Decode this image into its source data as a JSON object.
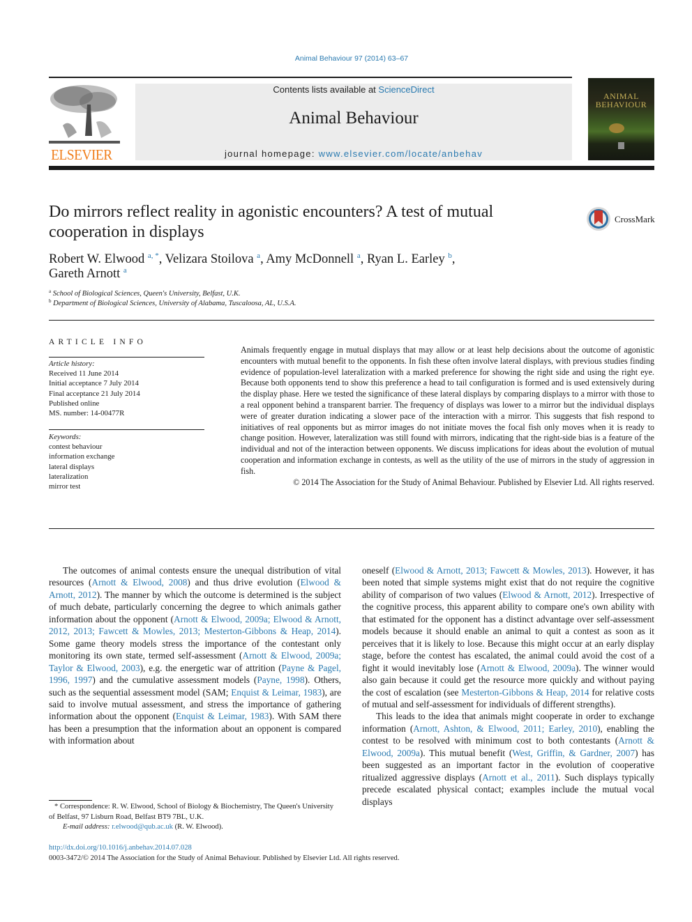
{
  "running_header": "Animal Behaviour 97 (2014) 63–67",
  "masthead": {
    "publisher_logo_text": "ELSEVIER",
    "contents_prefix": "Contents lists available at ",
    "contents_link": "ScienceDirect",
    "journal_title": "Animal Behaviour",
    "homepage_prefix": "journal homepage: ",
    "homepage_link": "www.elsevier.com/locate/anbehav",
    "cover_title_line1": "ANIMAL",
    "cover_title_line2": "BEHAVIOUR",
    "colors": {
      "elsevier_orange": "#f07d1a",
      "link_blue": "#2a7ab0",
      "masthead_gray": "#ececec"
    }
  },
  "article": {
    "title": "Do mirrors reflect reality in agonistic encounters? A test of mutual cooperation in displays",
    "crossmark_label": "CrossMark",
    "authors": [
      {
        "name": "Robert W. Elwood",
        "sup": "a, *"
      },
      {
        "name": "Velizara Stoilova",
        "sup": "a"
      },
      {
        "name": "Amy McDonnell",
        "sup": "a"
      },
      {
        "name": "Ryan L. Earley",
        "sup": "b"
      },
      {
        "name": "Gareth Arnott",
        "sup": "a"
      }
    ],
    "affiliations": [
      {
        "sup": "a",
        "text": "School of Biological Sciences, Queen's University, Belfast, U.K."
      },
      {
        "sup": "b",
        "text": "Department of Biological Sciences, University of Alabama, Tuscaloosa, AL, U.S.A."
      }
    ]
  },
  "article_info": {
    "heading": "ARTICLE INFO",
    "history_label": "Article history:",
    "history": [
      "Received 11 June 2014",
      "Initial acceptance 7 July 2014",
      "Final acceptance 21 July 2014",
      "Published online",
      "MS. number: 14-00477R"
    ],
    "keywords_label": "Keywords:",
    "keywords": [
      "contest behaviour",
      "information exchange",
      "lateral displays",
      "lateralization",
      "mirror test"
    ]
  },
  "abstract": {
    "text": "Animals frequently engage in mutual displays that may allow or at least help decisions about the outcome of agonistic encounters with mutual benefit to the opponents. In fish these often involve lateral displays, with previous studies finding evidence of population-level lateralization with a marked pref­erence for showing the right side and using the right eye. Because both opponents tend to show this preference a head to tail configuration is formed and is used extensively during the display phase. Here we tested the significance of these lateral displays by comparing displays to a mirror with those to a real opponent behind a transparent barrier. The frequency of displays was lower to a mirror but the indi­vidual displays were of greater duration indicating a slower pace of the interaction with a mirror. This suggests that fish respond to initiatives of real opponents but as mirror images do not initiate moves the focal fish only moves when it is ready to change position. However, lateralization was still found with mirrors, indicating that the right-side bias is a feature of the individual and not of the interaction be­tween opponents. We discuss implications for ideas about the evolution of mutual cooperation and information exchange in contests, as well as the utility of the use of mirrors in the study of aggression in fish.",
    "copyright": "© 2014 The Association for the Study of Animal Behaviour. Published by Elsevier Ltd. All rights reserved."
  },
  "body": {
    "left_column": [
      {
        "t": "The outcomes of animal contests ensure the unequal distribu­tion of vital resources ("
      },
      {
        "c": "Arnott & Elwood, 2008"
      },
      {
        "t": ") and thus drive evolution ("
      },
      {
        "c": "Elwood & Arnott, 2012"
      },
      {
        "t": "). The manner by which the outcome is determined is the subject of much debate, particularly concerning the degree to which animals gather information about the opponent ("
      },
      {
        "c": "Arnott & Elwood, 2009a; Elwood & Arnott, 2012, 2013; Fawcett & Mowles, 2013; Mesterton-Gibbons & Heap, 2014"
      },
      {
        "t": "). Some game theory models stress the importance of the contestant only monitoring its own state, termed self-assessment ("
      },
      {
        "c": "Arnott & Elwood, 2009a; Taylor & Elwood, 2003"
      },
      {
        "t": "), e.g. the ener­getic war of attrition ("
      },
      {
        "c": "Payne & Pagel, 1996, 1997"
      },
      {
        "t": ") and the cumula­tive assessment models ("
      },
      {
        "c": "Payne, 1998"
      },
      {
        "t": "). Others, such as the sequential assessment model (SAM; "
      },
      {
        "c": "Enquist & Leimar, 1983"
      },
      {
        "t": "), are said to involve mutual assessment, and stress the importance of gathering information about the opponent ("
      },
      {
        "c": "Enquist & Leimar, 1983"
      },
      {
        "t": "). With SAM there has been a presumption that the informa­tion about an opponent is compared with information about"
      }
    ],
    "right_column_p1": [
      {
        "t": "oneself ("
      },
      {
        "c": "Elwood & Arnott, 2013; Fawcett & Mowles, 2013"
      },
      {
        "t": "). How­ever, it has been noted that simple systems might exist that do not require the cognitive ability of comparison of two values ("
      },
      {
        "c": "Elwood & Arnott, 2012"
      },
      {
        "t": "). Irrespective of the cognitive process, this apparent ability to compare one's own ability with that estimated for the opponent has a distinct advantage over self-assessment models because it should enable an animal to quit a contest as soon as it perceives that it is likely to lose. Because this might occur at an early display stage, before the contest has escalated, the animal could avoid the cost of a fight it would inevitably lose ("
      },
      {
        "c": "Arnott & Elwood, 2009a"
      },
      {
        "t": "). The winner would also gain because it could get the resource more quickly and without paying the cost of escalation (see "
      },
      {
        "c": "Mesterton-Gibbons & Heap, 2014"
      },
      {
        "t": " for relative costs of mutual and self-assessment for individuals of different strengths)."
      }
    ],
    "right_column_p2": [
      {
        "t": "This leads to the idea that animals might cooperate in order to exchange information ("
      },
      {
        "c": "Arnott, Ashton, & Elwood, 2011; Earley, 2010"
      },
      {
        "t": "), enabling the contest to be resolved with minimum cost to both contestants ("
      },
      {
        "c": "Arnott & Elwood, 2009a"
      },
      {
        "t": "). This mutual benefit ("
      },
      {
        "c": "West, Griffin, & Gardner, 2007"
      },
      {
        "t": ") has been suggested as an impor­tant factor in the evolution of cooperative ritualized aggressive displays ("
      },
      {
        "c": "Arnott et al., 2011"
      },
      {
        "t": "). Such displays typically precede esca­lated physical contact; examples include the mutual vocal displays"
      }
    ]
  },
  "footnote": {
    "marker": "*",
    "correspondence": "Correspondence: R. W. Elwood, School of Biology & Biochemistry, The Queen's University of Belfast, 97 Lisburn Road, Belfast BT9 7BL, U.K.",
    "email_label": "E-mail address:",
    "email": "r.elwood@qub.ac.uk",
    "email_suffix": " (R. W. Elwood)."
  },
  "footer": {
    "doi": "http://dx.doi.org/10.1016/j.anbehav.2014.07.028",
    "issn_line": "0003-3472/© 2014 The Association for the Study of Animal Behaviour. Published by Elsevier Ltd. All rights reserved."
  }
}
